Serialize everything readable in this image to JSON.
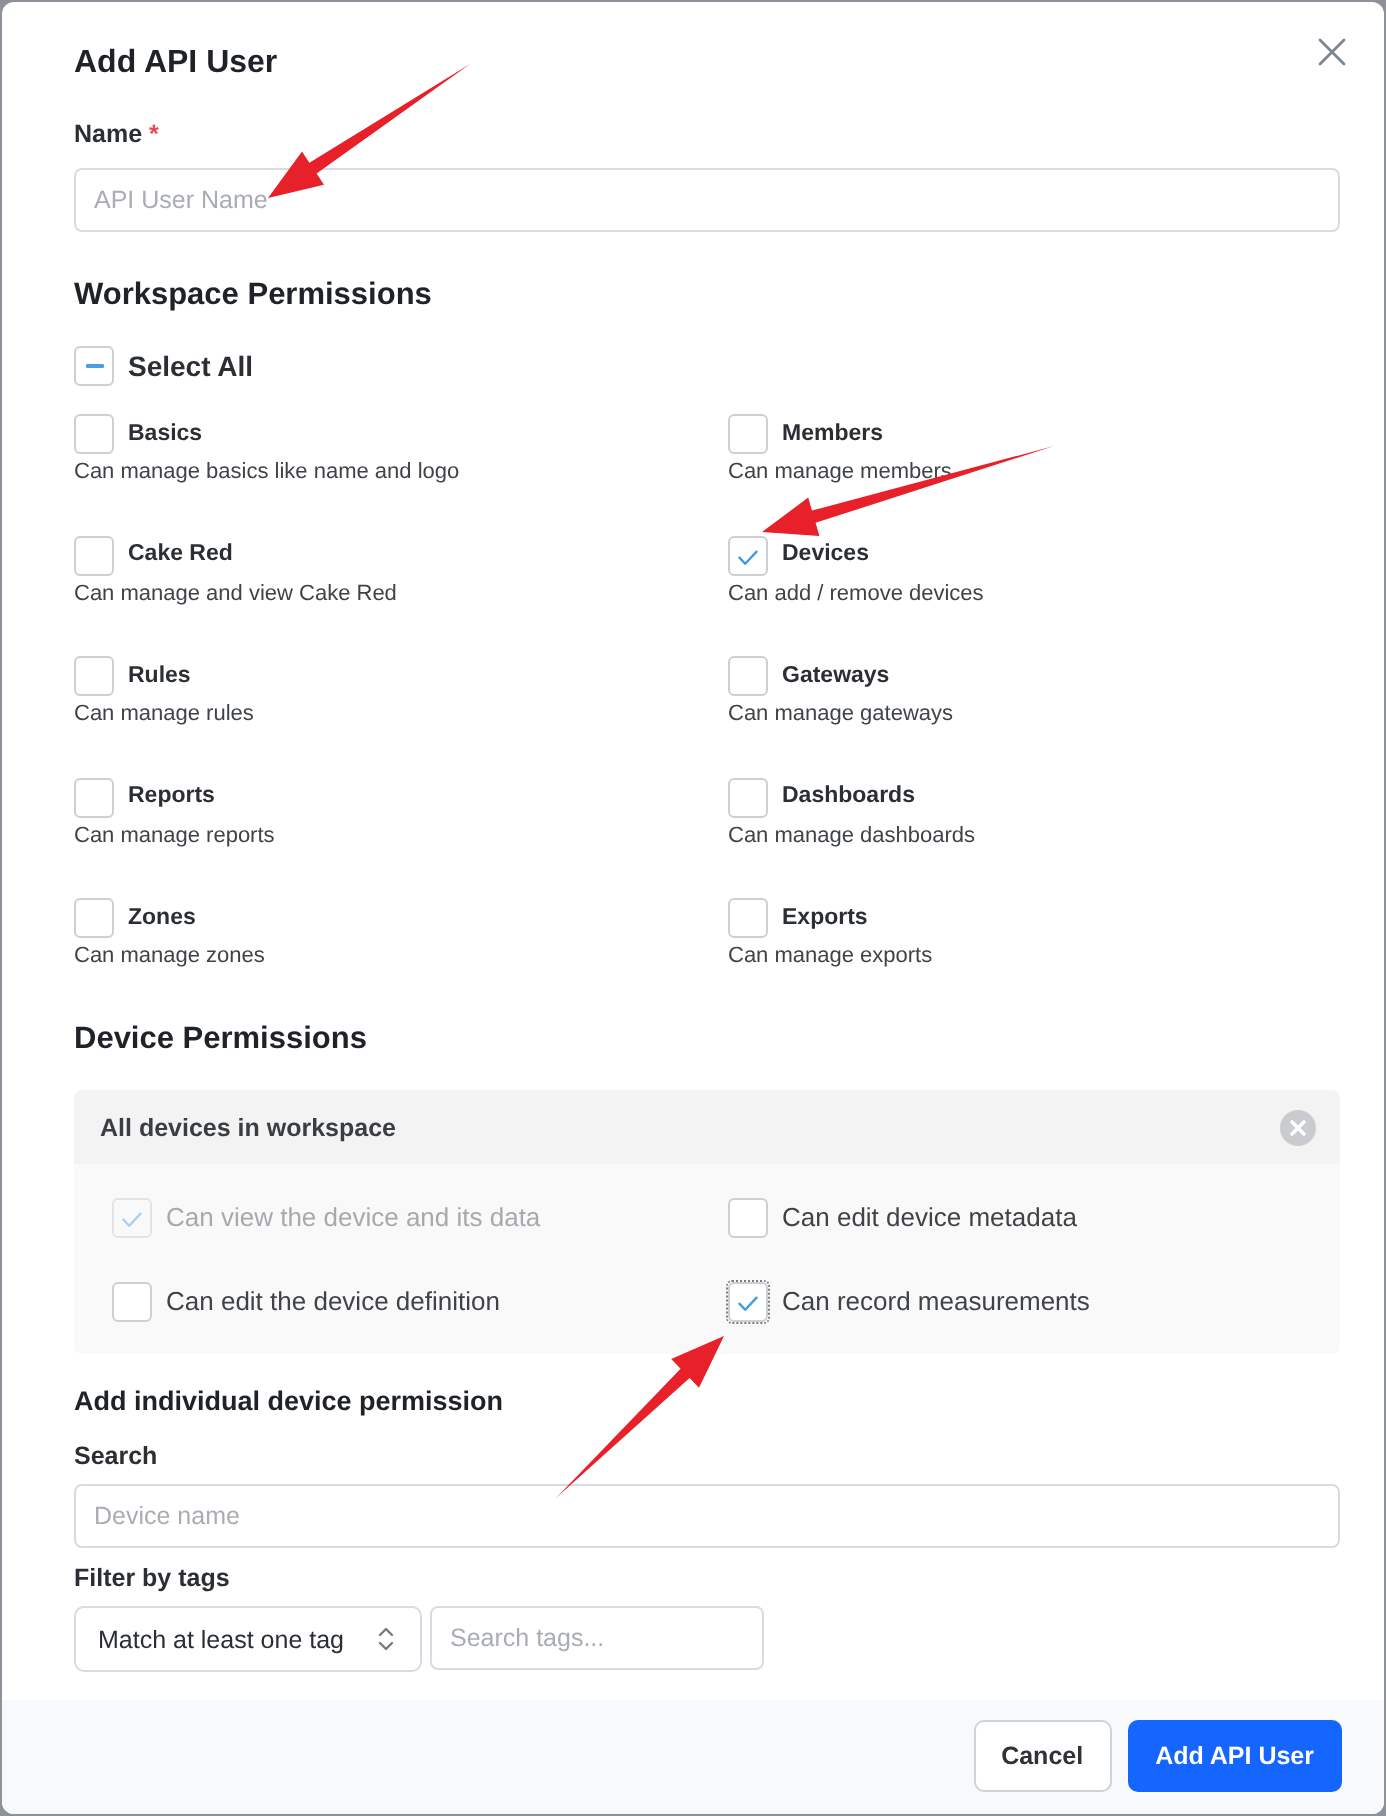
{
  "dialog": {
    "title": "Add API User"
  },
  "name_field": {
    "label": "Name",
    "required_mark": "*",
    "placeholder": "API User Name"
  },
  "workspace_permissions": {
    "heading": "Workspace Permissions",
    "select_all": {
      "label": "Select All",
      "indeterminate": true
    },
    "items": [
      {
        "label": "Basics",
        "description": "Can manage basics like name and logo",
        "checked": false
      },
      {
        "label": "Members",
        "description": "Can manage members",
        "checked": false
      },
      {
        "label": "Cake Red",
        "description": "Can manage and view Cake Red",
        "checked": false
      },
      {
        "label": "Devices",
        "description": "Can add / remove devices",
        "checked": true
      },
      {
        "label": "Rules",
        "description": "Can manage rules",
        "checked": false
      },
      {
        "label": "Gateways",
        "description": "Can manage gateways",
        "checked": false
      },
      {
        "label": "Reports",
        "description": "Can manage reports",
        "checked": false
      },
      {
        "label": "Dashboards",
        "description": "Can manage dashboards",
        "checked": false
      },
      {
        "label": "Zones",
        "description": "Can manage zones",
        "checked": false
      },
      {
        "label": "Exports",
        "description": "Can manage exports",
        "checked": false
      }
    ]
  },
  "device_permissions": {
    "heading": "Device Permissions",
    "panel": {
      "title": "All devices in workspace",
      "items": [
        {
          "label": "Can view the device and its data",
          "checked": true,
          "disabled": true,
          "focused": false
        },
        {
          "label": "Can edit device metadata",
          "checked": false,
          "disabled": false,
          "focused": false
        },
        {
          "label": "Can edit the device definition",
          "checked": false,
          "disabled": false,
          "focused": false
        },
        {
          "label": "Can record measurements",
          "checked": true,
          "disabled": false,
          "focused": true
        }
      ]
    }
  },
  "individual_permission": {
    "heading": "Add individual device permission",
    "search": {
      "label": "Search",
      "placeholder": "Device name"
    },
    "filter": {
      "label": "Filter by tags",
      "match_select": {
        "value": "Match at least one tag"
      },
      "tags_search": {
        "placeholder": "Search tags..."
      }
    }
  },
  "footer": {
    "buttons": [
      {
        "label": "Cancel",
        "kind": "secondary"
      },
      {
        "label": "Add API User",
        "kind": "primary"
      }
    ]
  },
  "annotations": [
    {
      "kind": "arrow"
    },
    {
      "kind": "arrow"
    },
    {
      "kind": "arrow"
    }
  ]
}
